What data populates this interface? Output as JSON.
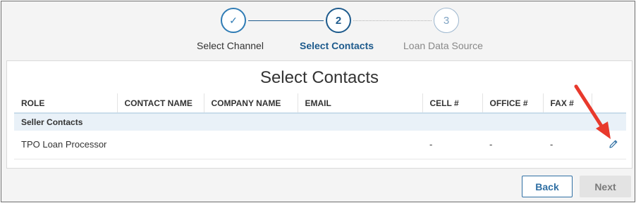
{
  "stepper": {
    "steps": [
      {
        "number": "✓",
        "label": "Select Channel"
      },
      {
        "number": "2",
        "label": "Select Contacts"
      },
      {
        "number": "3",
        "label": "Loan Data Source"
      }
    ]
  },
  "panel": {
    "title": "Select Contacts",
    "table": {
      "columns": [
        "ROLE",
        "CONTACT NAME",
        "COMPANY NAME",
        "EMAIL",
        "CELL #",
        "OFFICE #",
        "FAX #"
      ],
      "group_label": "Seller Contacts",
      "rows": [
        {
          "role": "TPO Loan Processor",
          "contact_name": "",
          "company_name": "",
          "email": "",
          "cell": "-",
          "office": "-",
          "fax": "-"
        }
      ]
    }
  },
  "footer": {
    "back_label": "Back",
    "next_label": "Next"
  },
  "colors": {
    "accent": "#1d5a8c",
    "annotation_arrow": "#e8392c"
  }
}
